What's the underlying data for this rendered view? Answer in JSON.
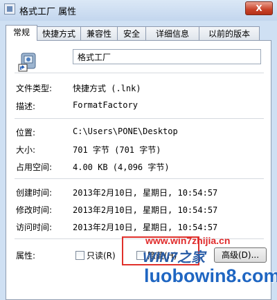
{
  "window": {
    "title": "格式工厂 属性",
    "close_label": "X"
  },
  "tabs": [
    {
      "label": "常规",
      "active": true
    },
    {
      "label": "快捷方式",
      "active": false
    },
    {
      "label": "兼容性",
      "active": false
    },
    {
      "label": "安全",
      "active": false
    },
    {
      "label": "详细信息",
      "active": false
    },
    {
      "label": "以前的版本",
      "active": false
    }
  ],
  "general": {
    "name": "格式工厂",
    "file_type": {
      "label": "文件类型:",
      "value": "快捷方式 (.lnk)"
    },
    "description": {
      "label": "描述:",
      "value": "FormatFactory"
    },
    "location": {
      "label": "位置:",
      "value": "C:\\Users\\PONE\\Desktop"
    },
    "size": {
      "label": "大小:",
      "value": "701 字节 (701 字节)"
    },
    "size_on_disk": {
      "label": "占用空间:",
      "value": "4.00 KB (4,096 字节)"
    },
    "created": {
      "label": "创建时间:",
      "value": "2013年2月10日, 星期日, 10:54:57"
    },
    "modified": {
      "label": "修改时间:",
      "value": "2013年2月10日, 星期日, 10:54:57"
    },
    "accessed": {
      "label": "访问时间:",
      "value": "2013年2月10日, 星期日, 10:54:57"
    },
    "attributes": {
      "label": "属性:",
      "readonly_label": "只读(R)",
      "hidden_label": "隐藏(H)",
      "advanced_label": "高级(D)..."
    }
  },
  "watermark": {
    "url": "www.win7zhijia.cn",
    "logo": "WIN7之家",
    "site": "luobowin8.com"
  }
}
